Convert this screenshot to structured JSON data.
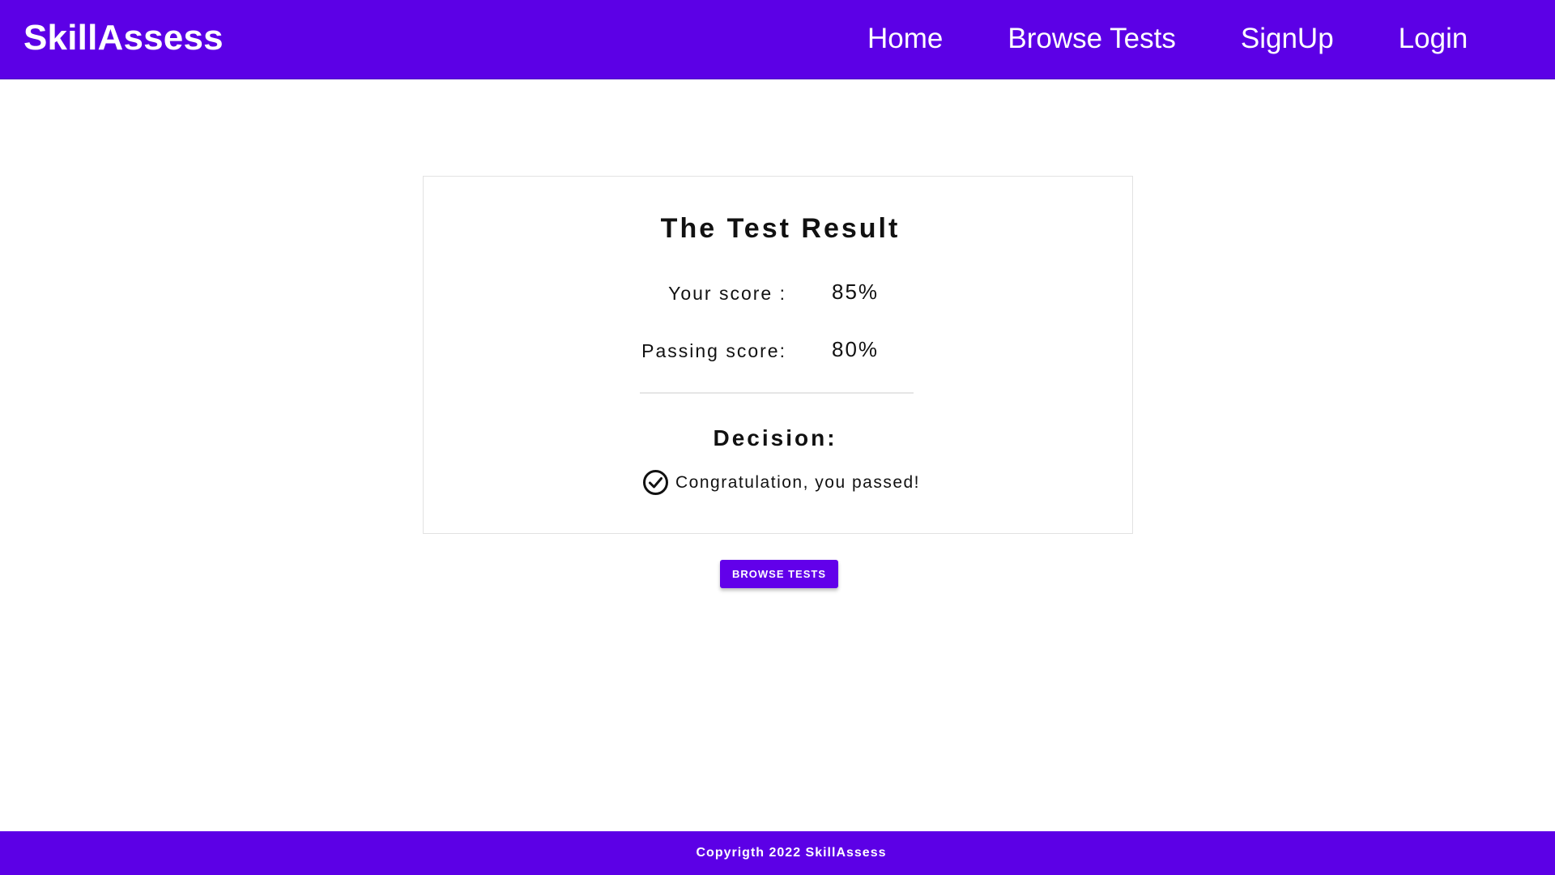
{
  "navbar": {
    "brand": "SkillAssess",
    "links": [
      {
        "label": "Home"
      },
      {
        "label": "Browse Tests"
      },
      {
        "label": "SignUp"
      },
      {
        "label": "Login"
      }
    ]
  },
  "result": {
    "title": "The Test Result",
    "your_score_label": "Your score :",
    "your_score_value": "85%",
    "passing_score_label": "Passing score:",
    "passing_score_value": "80%",
    "decision_title": "Decision:",
    "decision_icon": "check-circle-icon",
    "decision_message": "Congratulation, you passed!"
  },
  "actions": {
    "browse_tests_label": "BROWSE TESTS"
  },
  "footer": {
    "copyright": "Copyrigth 2022 SkillAssess"
  },
  "colors": {
    "primary": "#5c00e6",
    "button": "#6200ea",
    "background": "#ffffff"
  }
}
